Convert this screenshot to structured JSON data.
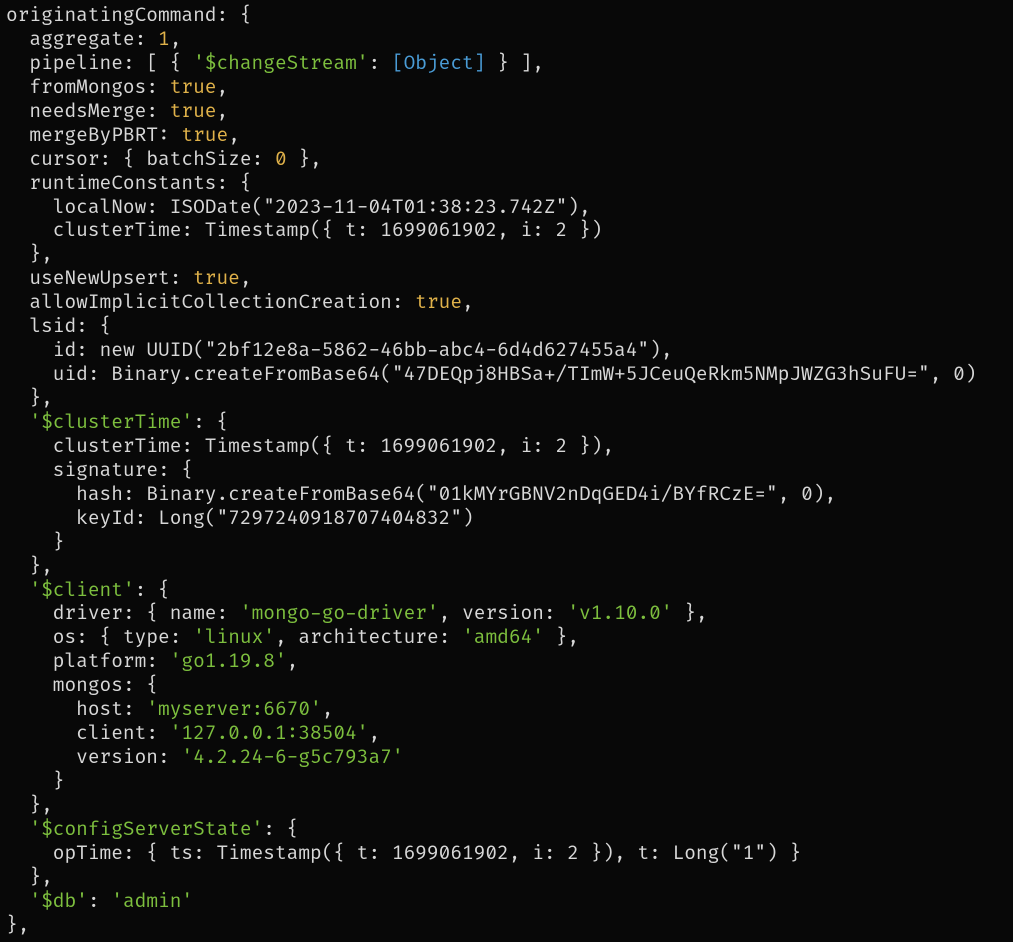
{
  "colors": {
    "bg": "#080808",
    "text": "#d8d8d8",
    "number": "#e0b24a",
    "string": "#7dbf3e",
    "object": "#4a9cd6"
  },
  "code": {
    "originatingCommand_key": "originatingCommand",
    "aggregate_key": "aggregate",
    "aggregate_val": "1",
    "pipeline_key": "pipeline",
    "changeStream_key": "'$changeStream'",
    "object_token": "[Object]",
    "fromMongos_key": "fromMongos",
    "true_val": "true",
    "needsMerge_key": "needsMerge",
    "mergeByPBRT_key": "mergeByPBRT",
    "cursor_key": "cursor",
    "batchSize_key": "batchSize",
    "batchSize_val": "0",
    "runtimeConstants_key": "runtimeConstants",
    "localNow_key": "localNow",
    "localNow_val": "ISODate(\"2023-11-04T01:38:23.742Z\")",
    "clusterTime_key": "clusterTime",
    "clusterTime_val": "Timestamp({ t: 1699061902, i: 2 })",
    "useNewUpsert_key": "useNewUpsert",
    "allowImplicitCollectionCreation_key": "allowImplicitCollectionCreation",
    "lsid_key": "lsid",
    "id_key": "id",
    "id_val": "new UUID(\"2bf12e8a-5862-46bb-abc4-6d4d627455a4\")",
    "uid_key": "uid",
    "uid_val": "Binary.createFromBase64(\"47DEQpj8HBSa+/TImW+5JCeuQeRkm5NMpJWZG3hSuFU=\", 0)",
    "dollarClusterTime_key": "'$clusterTime'",
    "signature_key": "signature",
    "hash_key": "hash",
    "hash_val": "Binary.createFromBase64(\"01kMYrGBNV2nDqGED4i/BYfRCzE=\", 0)",
    "keyId_key": "keyId",
    "keyId_val": "Long(\"7297240918707404832\")",
    "dollarClient_key": "'$client'",
    "driver_key": "driver",
    "name_key": "name",
    "driver_name_val": "'mongo-go-driver'",
    "version_key": "version",
    "driver_version_val": "'v1.10.0'",
    "os_key": "os",
    "type_key": "type",
    "os_type_val": "'linux'",
    "architecture_key": "architecture",
    "os_arch_val": "'amd64'",
    "platform_key": "platform",
    "platform_val": "'go1.19.8'",
    "mongos_key": "mongos",
    "host_key": "host",
    "host_val": "'myserver:6670'",
    "client_key": "client",
    "client_val": "'127.0.0.1:38504'",
    "mongos_version_val": "'4.2.24-6-g5c793a7'",
    "dollarConfigServerState_key": "'$configServerState'",
    "opTime_key": "opTime",
    "ts_key": "ts",
    "t_key": "t",
    "t_val": "Long(\"1\")",
    "dollarDb_key": "'$db'",
    "dollarDb_val": "'admin'"
  }
}
